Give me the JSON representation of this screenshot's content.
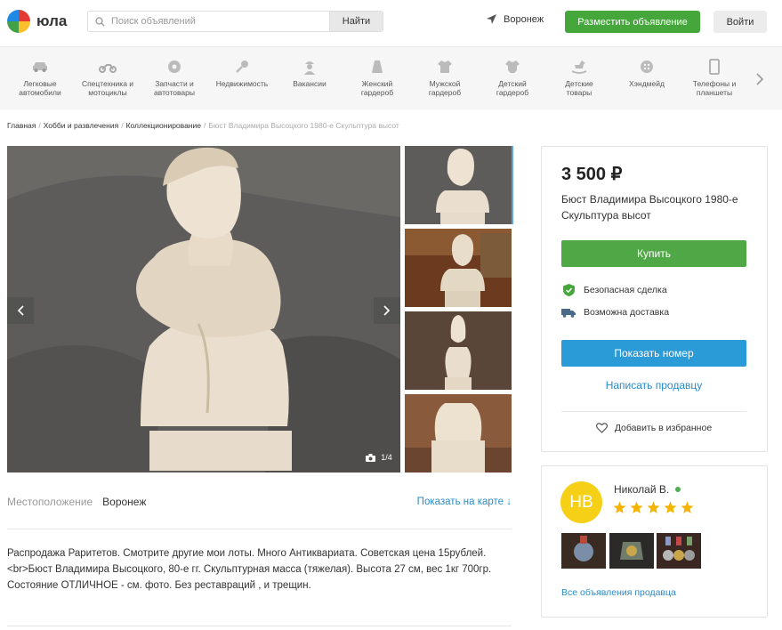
{
  "header": {
    "logo_text": "юла",
    "search_placeholder": "Поиск объявлений",
    "search_button": "Найти",
    "city": "Воронеж",
    "post_ad_button": "Разместить объявление",
    "login_button": "Войти"
  },
  "categories": [
    {
      "label": "Легковые\nавтомобили",
      "icon": "car-icon"
    },
    {
      "label": "Спецтехника и\nмотоциклы",
      "icon": "motorcycle-icon"
    },
    {
      "label": "Запчасти и\nавтотовары",
      "icon": "wheel-icon"
    },
    {
      "label": "Недвижимость",
      "icon": "key-icon"
    },
    {
      "label": "Вакансии",
      "icon": "worker-icon"
    },
    {
      "label": "Женский\nгардероб",
      "icon": "skirt-icon"
    },
    {
      "label": "Мужской\nгардероб",
      "icon": "shirt-icon"
    },
    {
      "label": "Детский\nгардероб",
      "icon": "bodysuit-icon"
    },
    {
      "label": "Детские\nтовары",
      "icon": "rocking-horse-icon"
    },
    {
      "label": "Хэндмейд",
      "icon": "button-icon"
    },
    {
      "label": "Телефоны и\nпланшеты",
      "icon": "phone-icon"
    }
  ],
  "breadcrumbs": [
    "Главная",
    "Хобби и развлечения",
    "Коллекционирование",
    "Бюст Владимира Высоцкого 1980-е Скульптура высот"
  ],
  "gallery": {
    "counter": "1/4"
  },
  "location": {
    "label": "Местоположение",
    "value": "Воронеж",
    "map_link": "Показать на карте ↓"
  },
  "description": {
    "line1": "Распродажа Раритетов. Смотрите другие мои лоты. Много Антиквариата. Советская цена 15рублей.",
    "line2": "<br>Бюст Владимира Высоцкого, 80-е гг. Скульптурная масса (тяжелая). Высота 27 см, вес 1кг 700гр. Состояние ОТЛИЧНОЕ - см. фото. Без реставраций , и трещин."
  },
  "listing": {
    "price": "3 500 ₽",
    "title": "Бюст Владимира Высоцкого 1980-е Скульптура высот",
    "buy_button": "Купить",
    "safe_deal": "Безопасная сделка",
    "delivery": "Возможна доставка",
    "show_phone_button": "Показать номер",
    "write_seller": "Написать продавцу",
    "add_favorite": "Добавить в избранное"
  },
  "seller": {
    "initials": "НВ",
    "name": "Николай В.",
    "rating": 5,
    "all_ads_link": "Все объявления продавца"
  },
  "colors": {
    "accent_green": "#45a63c",
    "accent_blue": "#2b9bd7",
    "link_blue": "#2b8bc7",
    "avatar_yellow": "#f5d016"
  }
}
